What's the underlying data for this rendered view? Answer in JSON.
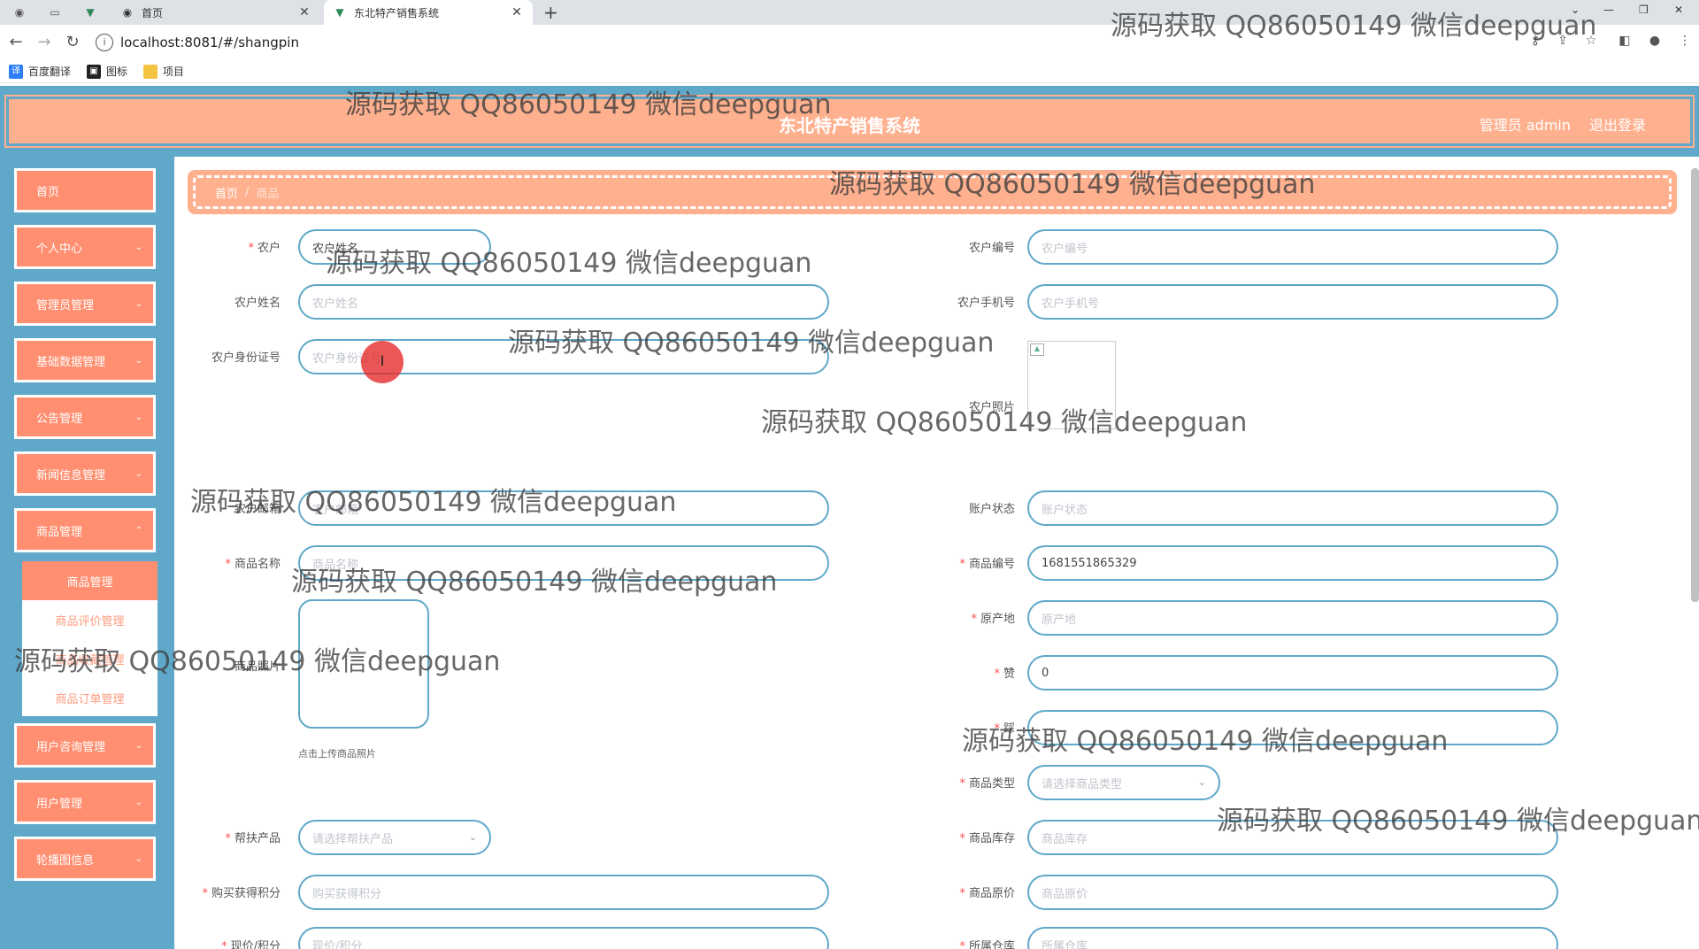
{
  "browser": {
    "tabs": [
      {
        "label": "首页",
        "active": false
      },
      {
        "label": "东北特产销售系统",
        "active": true
      }
    ],
    "url": "localhost:8081/#/shangpin",
    "bookmarks": [
      "百度翻译",
      "图标",
      "项目"
    ]
  },
  "header": {
    "title": "东北特产销售系统",
    "user": "管理员 admin",
    "logout": "退出登录"
  },
  "sidebar": {
    "items": [
      {
        "label": "首页",
        "has_children": false
      },
      {
        "label": "个人中心",
        "has_children": true
      },
      {
        "label": "管理员管理",
        "has_children": true
      },
      {
        "label": "基础数据管理",
        "has_children": true
      },
      {
        "label": "公告管理",
        "has_children": true
      },
      {
        "label": "新闻信息管理",
        "has_children": true
      },
      {
        "label": "商品管理",
        "has_children": true
      },
      {
        "label": "用户咨询管理",
        "has_children": true
      },
      {
        "label": "用户管理",
        "has_children": true
      },
      {
        "label": "轮播图信息",
        "has_children": true
      }
    ],
    "submenu": [
      "商品管理",
      "商品评价管理",
      "商品收藏管理",
      "商品订单管理"
    ]
  },
  "breadcrumb": {
    "home": "首页",
    "current": "商品"
  },
  "form": {
    "nonghu": {
      "label": "农户",
      "required": true,
      "placeholder": "农户姓名"
    },
    "nonghu_bianhao": {
      "label": "农户编号",
      "placeholder": "农户编号"
    },
    "nonghu_name": {
      "label": "农户姓名",
      "placeholder": "农户姓名"
    },
    "nonghu_phone": {
      "label": "农户手机号",
      "placeholder": "农户手机号"
    },
    "nonghu_idcard": {
      "label": "农户身份证号",
      "placeholder": "农户身份证号"
    },
    "nonghu_photo": {
      "label": "农户照片"
    },
    "nonghu_email": {
      "label": "农户邮箱",
      "placeholder": "农户邮箱"
    },
    "account_status": {
      "label": "账户状态",
      "placeholder": "账户状态"
    },
    "goods_name": {
      "label": "商品名称",
      "required": true,
      "placeholder": "商品名称"
    },
    "goods_no": {
      "label": "商品编号",
      "required": true,
      "value": "1681551865329"
    },
    "goods_photo": {
      "label": "商品照片",
      "hint": "点击上传商品照片"
    },
    "origin": {
      "label": "原产地",
      "required": true,
      "placeholder": "原产地"
    },
    "zan": {
      "label": "赞",
      "required": true,
      "value": "0"
    },
    "cai": {
      "label": "踩",
      "required": true,
      "value": ""
    },
    "goods_type": {
      "label": "商品类型",
      "required": true,
      "placeholder": "请选择商品类型"
    },
    "help_product": {
      "label": "帮扶产品",
      "required": true,
      "placeholder": "请选择帮扶产品"
    },
    "stock": {
      "label": "商品库存",
      "required": true,
      "placeholder": "商品库存"
    },
    "points": {
      "label": "购买获得积分",
      "required": true,
      "placeholder": "购买获得积分"
    },
    "orig_price": {
      "label": "商品原价",
      "required": true,
      "placeholder": "商品原价"
    },
    "current_price": {
      "label": "现价/积分",
      "required": true,
      "placeholder": "现价/积分"
    },
    "warehouse": {
      "label": "所属仓库",
      "required": true,
      "placeholder": "所属仓库"
    }
  },
  "watermark_text": "源码获取 QQ86050149 微信deepguan",
  "colors": {
    "accent": "#ff8f70",
    "header_bg": "#ffb08f",
    "sidebar_bg": "#5fa8c9",
    "input_border": "#5fa8c9"
  }
}
